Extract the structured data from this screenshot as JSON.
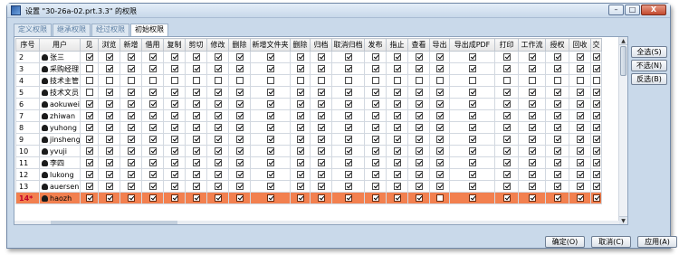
{
  "window": {
    "title": "设置 \"30-26a-02.prt.3.3\" 的权限",
    "minimize": "–",
    "maximize": "□",
    "close": "X"
  },
  "tabs": [
    "定义权限",
    "继承权限",
    "经过权限",
    "初始权限"
  ],
  "active_tab": 3,
  "table": {
    "headers": [
      "序号",
      "用户",
      "见",
      "浏览",
      "新增",
      "借用",
      "复制",
      "剪切",
      "修改",
      "删除",
      "新增文件夹",
      "删除",
      "归档",
      "取消归档",
      "发布",
      "指止",
      "查看",
      "导出",
      "导出成PDF",
      "打印",
      "工作流",
      "授权",
      "回收",
      "交"
    ],
    "rows": [
      {
        "num": "2",
        "user": "张三",
        "checks": [
          1,
          1,
          1,
          1,
          1,
          1,
          1,
          1,
          1,
          1,
          1,
          1,
          1,
          1,
          1,
          1,
          1,
          1,
          1,
          1,
          1,
          1
        ]
      },
      {
        "num": "3",
        "user": "采购经理",
        "checks": [
          0,
          1,
          1,
          1,
          1,
          1,
          1,
          1,
          1,
          1,
          1,
          1,
          1,
          1,
          1,
          1,
          1,
          1,
          1,
          1,
          1,
          1
        ]
      },
      {
        "num": "4",
        "user": "技术主管",
        "checks": [
          0,
          0,
          0,
          0,
          0,
          0,
          0,
          0,
          0,
          0,
          0,
          0,
          0,
          0,
          0,
          0,
          0,
          0,
          0,
          0,
          0,
          0
        ]
      },
      {
        "num": "5",
        "user": "技术文员",
        "checks": [
          0,
          1,
          1,
          1,
          1,
          1,
          1,
          1,
          1,
          1,
          1,
          1,
          1,
          1,
          1,
          1,
          1,
          1,
          1,
          1,
          1,
          1
        ]
      },
      {
        "num": "6",
        "user": "aokuwei",
        "checks": [
          1,
          1,
          1,
          1,
          1,
          1,
          1,
          1,
          1,
          1,
          1,
          1,
          1,
          1,
          1,
          1,
          1,
          1,
          1,
          1,
          1,
          1
        ]
      },
      {
        "num": "7",
        "user": "zhiwan",
        "checks": [
          1,
          1,
          1,
          1,
          1,
          1,
          1,
          1,
          1,
          1,
          1,
          1,
          1,
          1,
          1,
          1,
          1,
          1,
          1,
          1,
          1,
          1
        ]
      },
      {
        "num": "8",
        "user": "yuhong",
        "checks": [
          1,
          1,
          1,
          1,
          1,
          1,
          1,
          1,
          1,
          1,
          1,
          1,
          1,
          1,
          1,
          1,
          1,
          1,
          1,
          1,
          1,
          1
        ]
      },
      {
        "num": "9",
        "user": "jinsheng",
        "checks": [
          1,
          1,
          1,
          1,
          1,
          1,
          1,
          1,
          1,
          1,
          1,
          1,
          1,
          1,
          1,
          1,
          1,
          1,
          1,
          1,
          1,
          1
        ]
      },
      {
        "num": "10",
        "user": "yvuji",
        "checks": [
          1,
          1,
          1,
          1,
          1,
          1,
          1,
          1,
          1,
          1,
          1,
          1,
          1,
          1,
          1,
          1,
          1,
          1,
          1,
          1,
          1,
          1
        ]
      },
      {
        "num": "11",
        "user": "李四",
        "checks": [
          1,
          1,
          1,
          1,
          1,
          1,
          1,
          1,
          1,
          1,
          1,
          1,
          1,
          1,
          1,
          1,
          1,
          1,
          1,
          1,
          1,
          1
        ]
      },
      {
        "num": "12",
        "user": "lukong",
        "checks": [
          1,
          1,
          1,
          1,
          1,
          1,
          1,
          1,
          1,
          1,
          1,
          1,
          1,
          1,
          1,
          1,
          1,
          1,
          1,
          1,
          1,
          1
        ]
      },
      {
        "num": "13",
        "user": "auersen",
        "checks": [
          1,
          1,
          1,
          1,
          1,
          1,
          1,
          1,
          1,
          1,
          1,
          1,
          1,
          1,
          1,
          1,
          1,
          1,
          1,
          1,
          1,
          1
        ]
      },
      {
        "num": "14*",
        "user": "haozh",
        "checks": [
          1,
          1,
          1,
          1,
          1,
          1,
          1,
          1,
          1,
          1,
          1,
          1,
          1,
          1,
          1,
          0,
          1,
          1,
          1,
          1,
          1,
          1
        ],
        "selected": true
      }
    ]
  },
  "side_buttons": {
    "select_all": "全选(S)",
    "select_none": "不选(N)",
    "invert": "反选(B)"
  },
  "bottom_buttons": {
    "ok": "确定(O)",
    "cancel": "取消(C)",
    "apply": "应用(A)"
  },
  "colors": {
    "selected_row": "#f2804f",
    "window_bg": "#c9d9ea"
  }
}
